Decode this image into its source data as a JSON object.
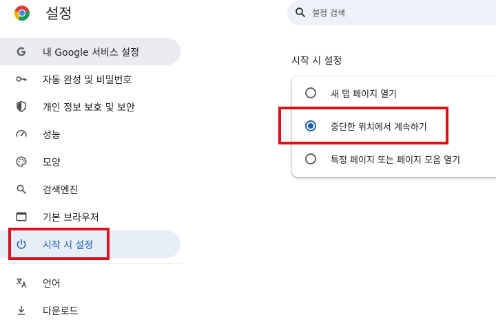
{
  "header": {
    "title": "설정",
    "search_placeholder": "설정 검색"
  },
  "sidebar": {
    "items": [
      {
        "label": "내 Google 서비스 설정",
        "icon": "google-g-icon"
      },
      {
        "label": "자동 완성 및 비밀번호",
        "icon": "key-icon"
      },
      {
        "label": "개인 정보 보호 및 보안",
        "icon": "shield-icon"
      },
      {
        "label": "성능",
        "icon": "speedometer-icon"
      },
      {
        "label": "모양",
        "icon": "palette-icon"
      },
      {
        "label": "검색엔진",
        "icon": "search-icon"
      },
      {
        "label": "기본 브라우저",
        "icon": "browser-window-icon"
      },
      {
        "label": "시작 시 설정",
        "icon": "power-icon",
        "active": true
      },
      {
        "label": "언어",
        "icon": "translate-icon"
      },
      {
        "label": "다운로드",
        "icon": "download-icon"
      }
    ]
  },
  "main": {
    "section_title": "시작 시 설정",
    "options": [
      {
        "label": "새 탭 페이지 열기",
        "checked": false
      },
      {
        "label": "중단한 위치에서 계속하기",
        "checked": true
      },
      {
        "label": "특정 페이지 또는 페이지 모음 열기",
        "checked": false
      }
    ]
  },
  "colors": {
    "accent": "#1a5fb4",
    "active_nav_bg": "#e8eef8",
    "highlight": "#d7141e",
    "search_bg": "#eef1f7"
  }
}
